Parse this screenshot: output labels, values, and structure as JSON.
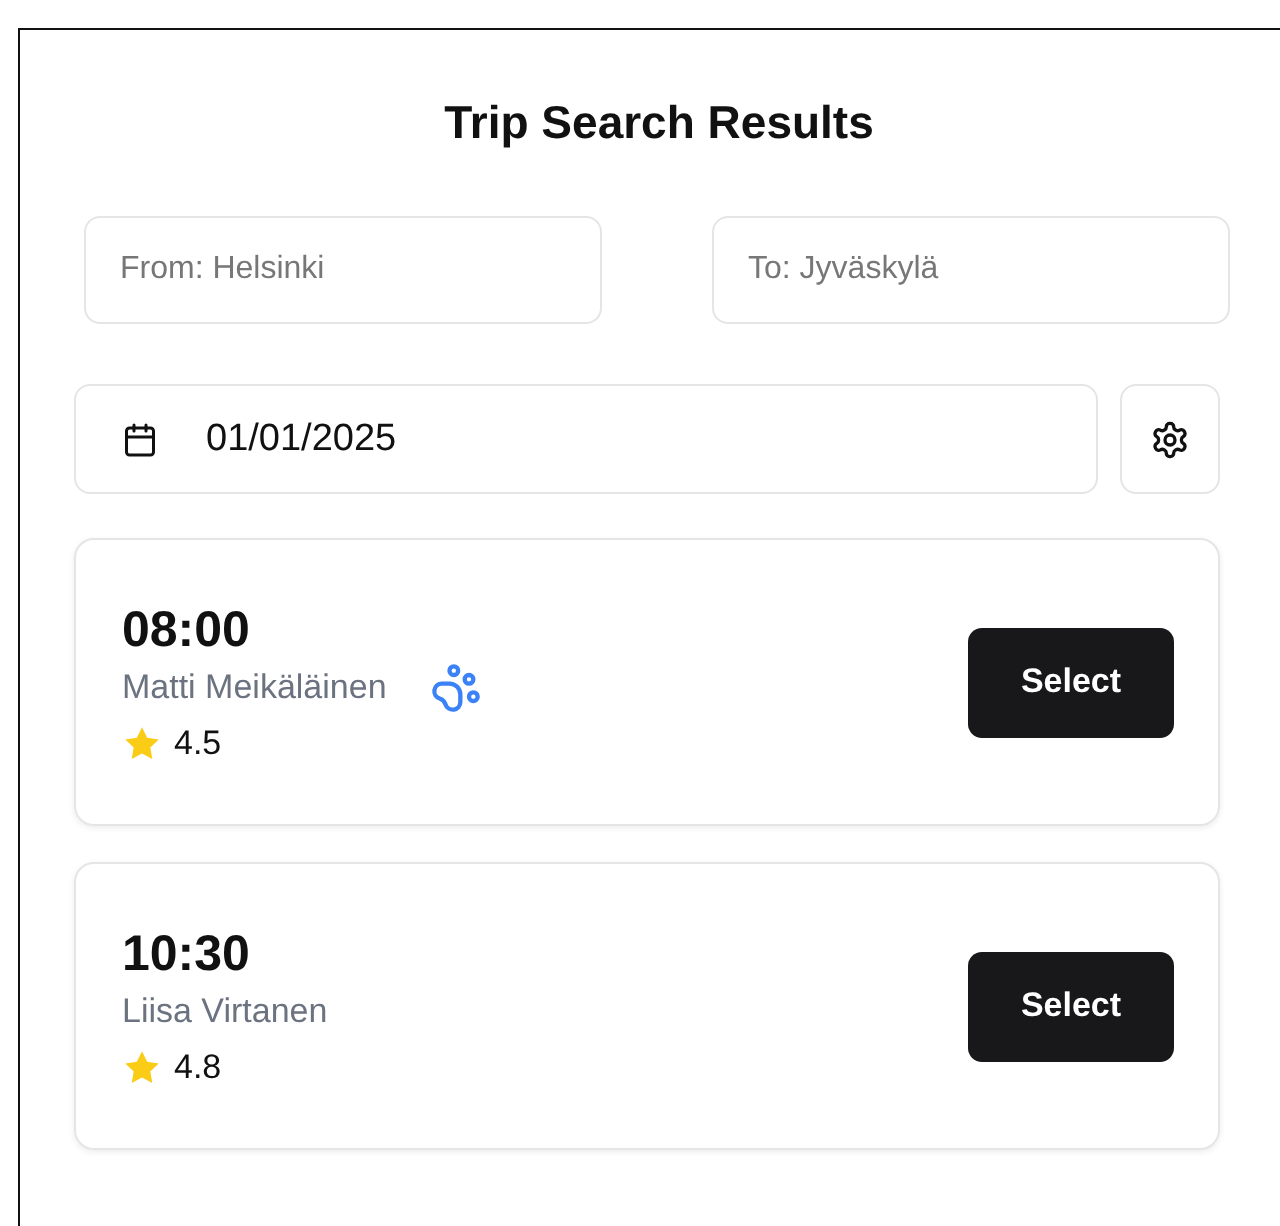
{
  "title": "Trip Search Results",
  "search": {
    "from": {
      "placeholder": "From: Helsinki"
    },
    "to": {
      "placeholder": "To: Jyväskylä"
    },
    "date": "01/01/2025"
  },
  "trips": [
    {
      "time": "08:00",
      "driver": "Matti Meikäläinen",
      "pets_allowed": true,
      "rating": "4.5",
      "button": "Select"
    },
    {
      "time": "10:30",
      "driver": "Liisa Virtanen",
      "pets_allowed": false,
      "rating": "4.8",
      "button": "Select"
    }
  ]
}
